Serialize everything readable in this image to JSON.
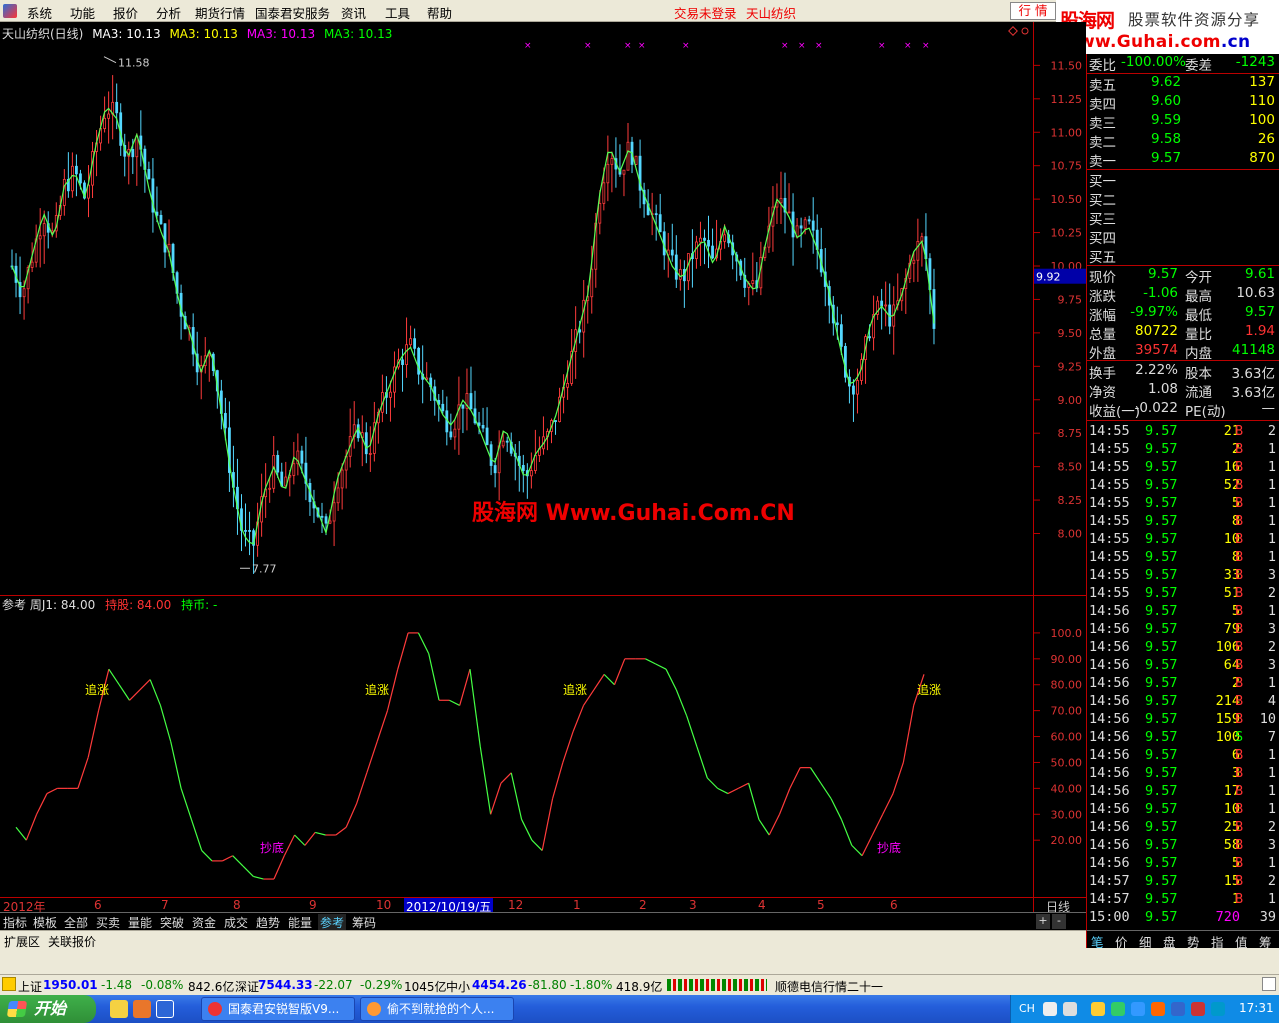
{
  "menu": {
    "items": [
      "系统",
      "功能",
      "报价",
      "分析",
      "期货行情",
      "国泰君安服务",
      "资讯",
      "工具",
      "帮助"
    ],
    "notice1": "交易未登录",
    "notice2": "天山纺织",
    "hq_button": "行 情"
  },
  "brand": {
    "line1": "股海网",
    "line2": "股票软件资源分享",
    "line3_main": "Www.Guhai.com",
    "line3_suffix": ".cn"
  },
  "price_panel": {
    "title": "天山纺织(日线)",
    "ma_labels": [
      "MA3: 10.13",
      "MA3: 10.13",
      "MA3: 10.13",
      "MA3: 10.13"
    ],
    "ma_colors": [
      "#ffffff",
      "#ffff00",
      "#ff00ff",
      "#00ff00"
    ],
    "high_label": "11.58",
    "low_label": "7.77",
    "current_tag": "9.92",
    "watermark": "股海网 Www.Guhai.Com.CN"
  },
  "indicator_panel": {
    "name": "参考",
    "line": "周J1: 84.00",
    "hold_stock": "持股: 84.00",
    "hold_cash": "持币: -",
    "signals": [
      "追涨",
      "追涨",
      "追涨",
      "追涨",
      "抄底",
      "抄底"
    ]
  },
  "date_axis": {
    "labels": [
      "2012年",
      "6",
      "7",
      "8",
      "9",
      "10",
      "2012/10/19/五",
      "12",
      "1",
      "2",
      "3",
      "4",
      "5",
      "6"
    ],
    "right_label": "日线"
  },
  "bottom_tabs": [
    "指标",
    "模板",
    "全部",
    "买卖",
    "量能",
    "突破",
    "资金",
    "成交",
    "趋势",
    "能量",
    "参考",
    "筹码"
  ],
  "tab_controls": [
    "+",
    "-"
  ],
  "expand_row": [
    "扩展区",
    "关联报价"
  ],
  "quote": {
    "weibi_label": "委比",
    "weibi_value": "-100.00%",
    "weicha_label": "委差",
    "weicha_value": "-1243",
    "sell": [
      {
        "label": "卖五",
        "price": "9.62",
        "vol": "137"
      },
      {
        "label": "卖四",
        "price": "9.60",
        "vol": "110"
      },
      {
        "label": "卖三",
        "price": "9.59",
        "vol": "100"
      },
      {
        "label": "卖二",
        "price": "9.58",
        "vol": "26"
      },
      {
        "label": "卖一",
        "price": "9.57",
        "vol": "870"
      }
    ],
    "buy": [
      "买一",
      "买二",
      "买三",
      "买四",
      "买五"
    ],
    "stats": [
      {
        "l1": "现价",
        "v1": "9.57",
        "c1": "gr",
        "l2": "今开",
        "v2": "9.61",
        "c2": "gr"
      },
      {
        "l1": "涨跌",
        "v1": "-1.06",
        "c1": "gr",
        "l2": "最高",
        "v2": "10.63",
        "c2": "wh"
      },
      {
        "l1": "涨幅",
        "v1": "-9.97%",
        "c1": "gr",
        "l2": "最低",
        "v2": "9.57",
        "c2": "gr"
      },
      {
        "l1": "总量",
        "v1": "80722",
        "c1": "ye",
        "l2": "量比",
        "v2": "1.94",
        "c2": "pr"
      },
      {
        "l1": "外盘",
        "v1": "39574",
        "c1": "pr",
        "l2": "内盘",
        "v2": "41148",
        "c2": "gr"
      }
    ],
    "stats2": [
      {
        "l1": "换手",
        "v1": "2.22%",
        "l2": "股本",
        "v2": "3.63亿"
      },
      {
        "l1": "净资",
        "v1": "1.08",
        "l2": "流通",
        "v2": "3.63亿"
      },
      {
        "l1": "收益(一)",
        "v1": "-0.022",
        "l2": "PE(动)",
        "v2": "—"
      }
    ]
  },
  "trades": [
    {
      "t": "14:55",
      "p": "9.57",
      "v": "21",
      "s": "B",
      "n": "2"
    },
    {
      "t": "14:55",
      "p": "9.57",
      "v": "2",
      "s": "B",
      "n": "1"
    },
    {
      "t": "14:55",
      "p": "9.57",
      "v": "16",
      "s": "B",
      "n": "1"
    },
    {
      "t": "14:55",
      "p": "9.57",
      "v": "52",
      "s": "B",
      "n": "1"
    },
    {
      "t": "14:55",
      "p": "9.57",
      "v": "5",
      "s": "B",
      "n": "1"
    },
    {
      "t": "14:55",
      "p": "9.57",
      "v": "8",
      "s": "B",
      "n": "1"
    },
    {
      "t": "14:55",
      "p": "9.57",
      "v": "10",
      "s": "B",
      "n": "1"
    },
    {
      "t": "14:55",
      "p": "9.57",
      "v": "8",
      "s": "B",
      "n": "1"
    },
    {
      "t": "14:55",
      "p": "9.57",
      "v": "33",
      "s": "B",
      "n": "3"
    },
    {
      "t": "14:55",
      "p": "9.57",
      "v": "51",
      "s": "B",
      "n": "2"
    },
    {
      "t": "14:56",
      "p": "9.57",
      "v": "5",
      "s": "B",
      "n": "1"
    },
    {
      "t": "14:56",
      "p": "9.57",
      "v": "79",
      "s": "B",
      "n": "3"
    },
    {
      "t": "14:56",
      "p": "9.57",
      "v": "106",
      "s": "B",
      "n": "2"
    },
    {
      "t": "14:56",
      "p": "9.57",
      "v": "64",
      "s": "B",
      "n": "3"
    },
    {
      "t": "14:56",
      "p": "9.57",
      "v": "2",
      "s": "B",
      "n": "1"
    },
    {
      "t": "14:56",
      "p": "9.57",
      "v": "214",
      "s": "B",
      "n": "4"
    },
    {
      "t": "14:56",
      "p": "9.57",
      "v": "159",
      "s": "B",
      "n": "10"
    },
    {
      "t": "14:56",
      "p": "9.57",
      "v": "100",
      "s": "S",
      "n": "7"
    },
    {
      "t": "14:56",
      "p": "9.57",
      "v": "6",
      "s": "B",
      "n": "1"
    },
    {
      "t": "14:56",
      "p": "9.57",
      "v": "3",
      "s": "B",
      "n": "1"
    },
    {
      "t": "14:56",
      "p": "9.57",
      "v": "17",
      "s": "B",
      "n": "1"
    },
    {
      "t": "14:56",
      "p": "9.57",
      "v": "10",
      "s": "B",
      "n": "1"
    },
    {
      "t": "14:56",
      "p": "9.57",
      "v": "25",
      "s": "B",
      "n": "2"
    },
    {
      "t": "14:56",
      "p": "9.57",
      "v": "58",
      "s": "B",
      "n": "3"
    },
    {
      "t": "14:56",
      "p": "9.57",
      "v": "5",
      "s": "B",
      "n": "1"
    },
    {
      "t": "14:57",
      "p": "9.57",
      "v": "15",
      "s": "B",
      "n": "2"
    },
    {
      "t": "14:57",
      "p": "9.57",
      "v": "1",
      "s": "B",
      "n": "1"
    },
    {
      "t": "15:00",
      "p": "9.57",
      "v": "720",
      "s": "",
      "n": "39"
    }
  ],
  "right_tabs": [
    "笔",
    "价",
    "细",
    "盘",
    "势",
    "指",
    "值",
    "筹"
  ],
  "status": {
    "sh_label": "上证",
    "sh_val": "1950.01",
    "sh_chg": "-1.48",
    "sh_pct": "-0.08%",
    "sh_amt": "842.6亿",
    "sz_label": "深证",
    "sz_val": "7544.33",
    "sz_chg": "-22.07",
    "sz_pct": "-0.29%",
    "sz_amt": "1045亿",
    "zx_label": "中小",
    "zx_val": "4454.26",
    "zx_chg": "-81.80",
    "zx_pct": "-1.80%",
    "zx_amt": "418.9亿",
    "ticker": "顺德电信行情二十一"
  },
  "taskbar": {
    "start": "开始",
    "tasks": [
      "国泰君安锐智版V9...",
      "偷不到就抢的个人..."
    ],
    "lang": "CH",
    "clock": "17:31"
  },
  "chart_data": [
    {
      "type": "candlestick",
      "title": "天山纺织(日线)",
      "y_axis_ticks": [
        "11.50",
        "11.25",
        "11.00",
        "10.75",
        "10.50",
        "10.25",
        "10.00",
        "9.75",
        "9.50",
        "9.25",
        "9.00",
        "8.75",
        "8.50",
        "8.25",
        "8.00"
      ],
      "ylim": [
        7.6,
        11.6
      ],
      "high": 11.58,
      "low": 7.77,
      "close_path": [
        10.0,
        9.8,
        10.1,
        10.4,
        10.2,
        10.6,
        10.7,
        10.5,
        10.9,
        11.2,
        11.1,
        10.8,
        11.0,
        10.6,
        10.3,
        10.1,
        9.7,
        9.5,
        9.2,
        9.4,
        8.9,
        8.4,
        8.0,
        7.9,
        8.3,
        8.5,
        8.3,
        8.6,
        8.4,
        8.2,
        8.0,
        8.4,
        8.6,
        8.8,
        8.6,
        8.9,
        9.1,
        9.3,
        9.4,
        9.2,
        9.1,
        8.9,
        8.8,
        9.0,
        8.9,
        8.7,
        8.5,
        8.8,
        8.6,
        8.4,
        8.6,
        8.7,
        8.9,
        9.2,
        9.5,
        9.8,
        10.5,
        10.9,
        10.7,
        10.9,
        10.6,
        10.4,
        10.2,
        10.0,
        9.9,
        10.1,
        10.2,
        10.0,
        10.3,
        10.1,
        9.9,
        9.8,
        10.2,
        10.5,
        10.4,
        10.2,
        10.3,
        10.1,
        9.8,
        9.4,
        9.1,
        9.2,
        9.6,
        9.7,
        9.6,
        9.8,
        10.1,
        10.2,
        9.57
      ]
    },
    {
      "type": "line",
      "title": "参考 周J1",
      "y_axis_ticks": [
        "100.0",
        "90.00",
        "80.00",
        "70.00",
        "60.00",
        "50.00",
        "40.00",
        "30.00",
        "20.00"
      ],
      "ylim": [
        0,
        110
      ],
      "values": [
        25,
        20,
        30,
        38,
        40,
        40,
        40,
        52,
        70,
        86,
        80,
        74,
        78,
        82,
        72,
        58,
        40,
        28,
        16,
        12,
        12,
        14,
        10,
        6,
        5,
        5,
        14,
        22,
        18,
        23,
        22,
        22,
        25,
        34,
        46,
        58,
        70,
        86,
        100,
        100,
        92,
        74,
        74,
        72,
        86,
        56,
        30,
        42,
        46,
        28,
        20,
        16,
        36,
        50,
        62,
        72,
        78,
        84,
        80,
        90,
        90,
        90,
        88,
        86,
        78,
        68,
        56,
        44,
        40,
        38,
        40,
        42,
        28,
        22,
        30,
        40,
        48,
        48,
        42,
        36,
        28,
        18,
        14,
        22,
        30,
        38,
        50,
        72,
        84
      ]
    }
  ]
}
